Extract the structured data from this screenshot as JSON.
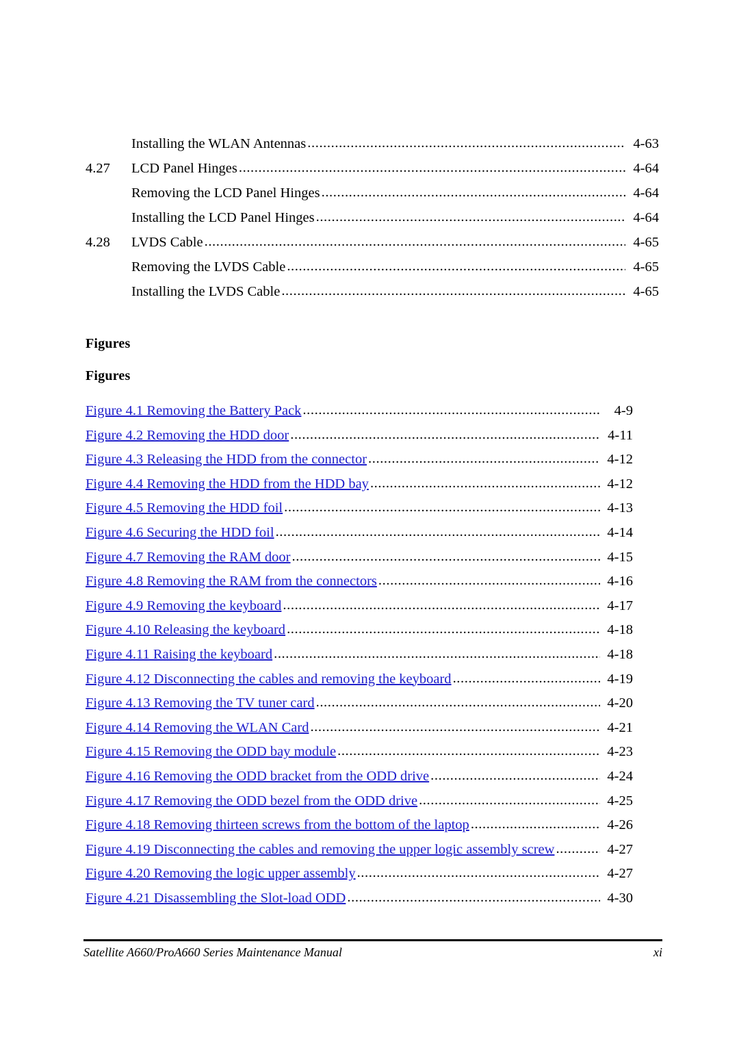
{
  "document": {
    "type": "table-of-contents-page",
    "footer": {
      "title": "Satellite A660/ProA660 Series Maintenance Manual",
      "page_number": "xi"
    }
  },
  "toc": {
    "entries": [
      {
        "number": "",
        "title": "Installing the WLAN Antennas",
        "page": "4-63",
        "level": "sub"
      },
      {
        "number": "4.27",
        "title": "LCD Panel Hinges",
        "page": "4-64",
        "level": "section"
      },
      {
        "number": "",
        "title": "Removing the LCD Panel Hinges",
        "page": "4-64",
        "level": "sub"
      },
      {
        "number": "",
        "title": "Installing the LCD Panel Hinges",
        "page": "4-64",
        "level": "sub"
      },
      {
        "number": "4.28",
        "title": "LVDS Cable",
        "page": "4-65",
        "level": "section"
      },
      {
        "number": "",
        "title": "Removing the LVDS Cable",
        "page": "4-65",
        "level": "sub"
      },
      {
        "number": "",
        "title": "Installing the LVDS Cable",
        "page": "4-65",
        "level": "sub"
      }
    ]
  },
  "figures_section": {
    "heading_1": "Figures",
    "heading_2": "Figures",
    "link_color": "#2020CC",
    "entries": [
      {
        "label": "Figure 4.1 Removing the Battery Pack",
        "page": "4-9"
      },
      {
        "label": "Figure 4.2 Removing the HDD door",
        "page": "4-11"
      },
      {
        "label": "Figure 4.3 Releasing the HDD from the connector",
        "page": "4-12"
      },
      {
        "label": "Figure 4.4 Removing the HDD from the HDD bay",
        "page": "4-12"
      },
      {
        "label": "Figure 4.5 Removing the HDD foil",
        "page": "4-13"
      },
      {
        "label": "Figure 4.6 Securing the HDD foil",
        "page": "4-14"
      },
      {
        "label": "Figure 4.7 Removing the RAM door",
        "page": "4-15"
      },
      {
        "label": "Figure 4.8 Removing the RAM from the connectors",
        "page": "4-16"
      },
      {
        "label": "Figure 4.9 Removing the keyboard",
        "page": "4-17"
      },
      {
        "label": "Figure 4.10 Releasing the keyboard",
        "page": "4-18"
      },
      {
        "label": "Figure 4.11 Raising the keyboard",
        "page": "4-18"
      },
      {
        "label": "Figure 4.12 Disconnecting the cables and removing the keyboard",
        "page": "4-19"
      },
      {
        "label": "Figure 4.13 Removing the TV tuner card",
        "page": "4-20"
      },
      {
        "label": "Figure 4.14 Removing the WLAN Card",
        "page": "4-21"
      },
      {
        "label": "Figure 4.15 Removing the ODD bay module",
        "page": "4-23"
      },
      {
        "label": "Figure 4.16 Removing the ODD bracket from the ODD drive",
        "page": "4-24"
      },
      {
        "label": "Figure 4.17 Removing the ODD bezel from the ODD drive",
        "page": "4-25"
      },
      {
        "label": "Figure 4.18 Removing thirteen screws from the bottom of the laptop",
        "page": "4-26"
      },
      {
        "label": "Figure 4.19 Disconnecting the cables and removing the upper logic assembly screw",
        "page": "4-27"
      },
      {
        "label": "Figure 4.20 Removing the logic upper assembly",
        "page": "4-27"
      },
      {
        "label": "Figure 4.21 Disassembling the Slot-load ODD",
        "page": "4-30"
      }
    ]
  }
}
